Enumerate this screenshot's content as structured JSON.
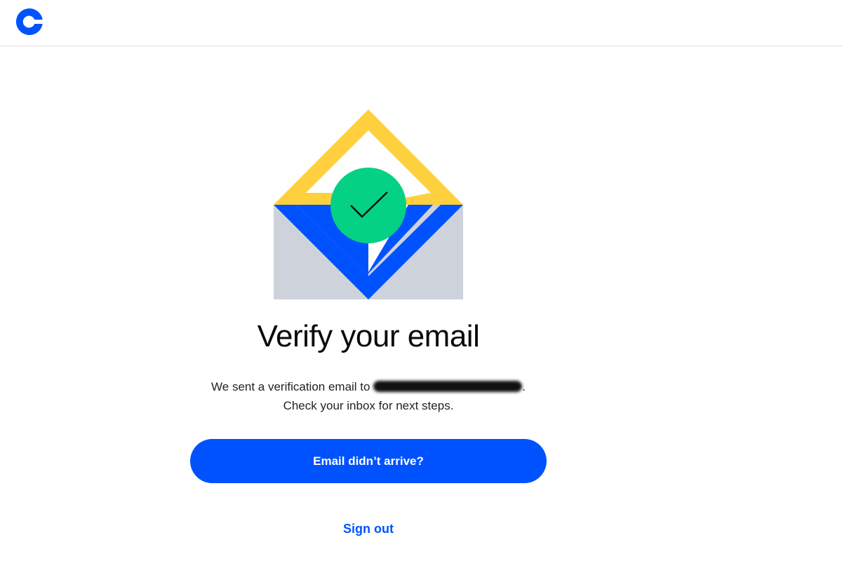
{
  "header": {
    "logo_icon": "coinbase-logo-icon",
    "brand_color": "#0052ff"
  },
  "illustration": {
    "icon": "envelope-checkmark-icon",
    "colors": {
      "flap": "#ffd03e",
      "envelope_blue": "#0052ff",
      "envelope_gray": "#ced2db",
      "check_circle": "#05d184"
    }
  },
  "main": {
    "title": "Verify your email",
    "message_prefix": "We sent a verification email to",
    "message_suffix": ".",
    "message_line2": "Check your inbox for next steps.",
    "resend_button": "Email didn’t arrive?",
    "sign_out_link": "Sign out"
  }
}
